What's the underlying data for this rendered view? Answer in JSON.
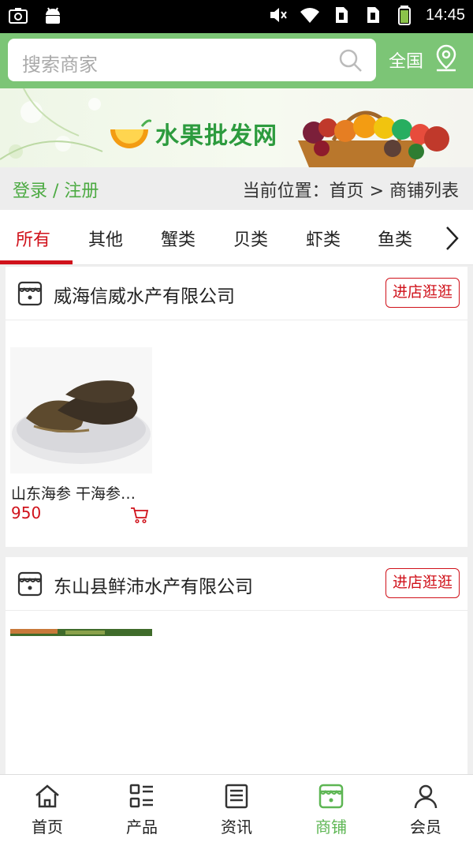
{
  "status_bar": {
    "time": "14:45"
  },
  "search": {
    "placeholder": "搜索商家",
    "region": "全国"
  },
  "banner": {
    "title": "水果批发网"
  },
  "breadcrumb": {
    "login": "登录 / 注册",
    "location": "当前位置：首页 > 商铺列表"
  },
  "tabs": [
    {
      "label": "所有",
      "active": true
    },
    {
      "label": "其他"
    },
    {
      "label": "蟹类"
    },
    {
      "label": "贝类"
    },
    {
      "label": "虾类"
    },
    {
      "label": "鱼类"
    }
  ],
  "shops": [
    {
      "name": "威海信威水产有限公司",
      "visit_label": "进店逛逛",
      "products": [
        {
          "name": "山东海参 干海参…",
          "price": "950"
        }
      ]
    },
    {
      "name": "东山县鲜沛水产有限公司",
      "visit_label": "进店逛逛",
      "products": []
    }
  ],
  "bottom_nav": [
    {
      "label": "首页",
      "icon": "home-icon"
    },
    {
      "label": "产品",
      "icon": "grid-list-icon"
    },
    {
      "label": "资讯",
      "icon": "news-icon"
    },
    {
      "label": "商铺",
      "icon": "shop-icon",
      "active": true
    },
    {
      "label": "会员",
      "icon": "user-icon"
    }
  ],
  "colors": {
    "accent_green": "#7cc576",
    "active_red": "#d0121b",
    "nav_active": "#5db653"
  }
}
